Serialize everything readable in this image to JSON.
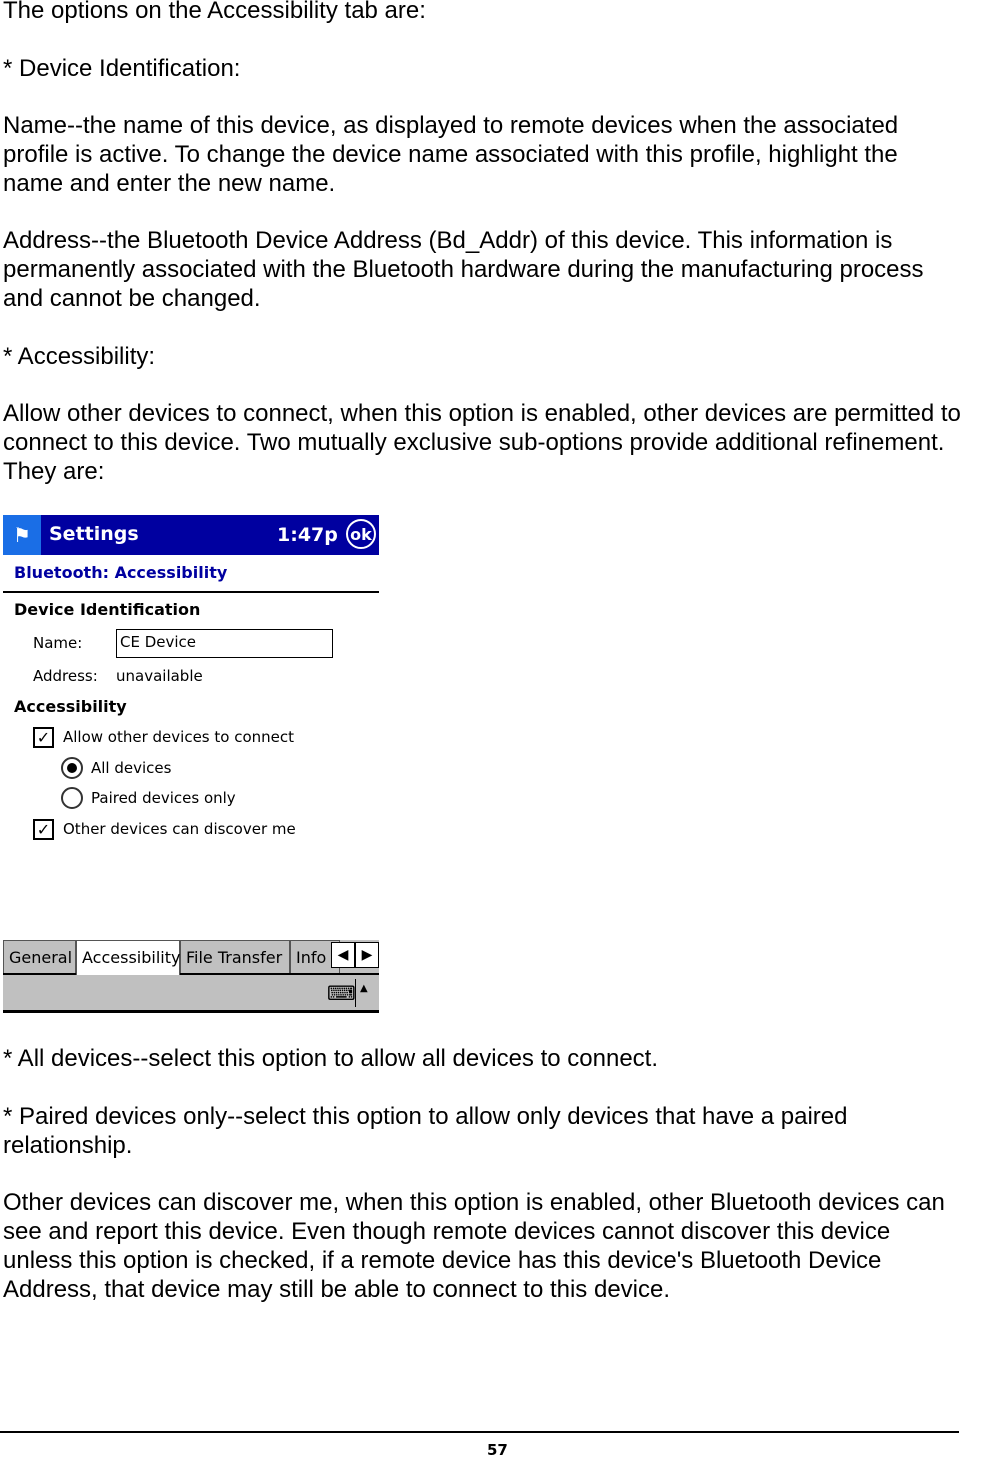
{
  "paragraphs": [
    "The options on the Accessibility tab are:",
    "* Device Identification:",
    "Name--the name of this device, as displayed to remote devices when the associated\nprofile is active. To change the device name associated with this profile, highlight the\nname and enter the new name.",
    "Address--the Bluetooth Device Address (Bd_Addr) of this device. This information is\npermanently associated with the Bluetooth hardware during the manufacturing process\nand cannot be changed.",
    "* Accessibility:",
    "Allow other devices to connect, when this option is enabled, other devices are permitted to\nconnect to this device. Two mutually exclusive sub-options provide additional refinement.\nThey are:",
    "* All devices--select this option to allow all devices to connect.",
    "* Paired devices only--select this option to allow only devices that have a paired\nrelationship.",
    "Other devices can discover me, when this option is enabled, other Bluetooth devices can\nsee and report this device. Even though remote devices cannot discover this device\nunless this option is checked, if a remote device has this device's Bluetooth Device\nAddress, that device may still be able to connect to this device."
  ],
  "screen": {
    "title": "Settings",
    "time": "1:47p",
    "ok": "ok",
    "subtitle": "Bluetooth: Accessibility",
    "device_id_heading": "Device Identification",
    "name_label": "Name:",
    "name_value": "CE Device",
    "address_label": "Address:",
    "address_value": "unavailable",
    "accessibility_heading": "Accessibility",
    "allow_connect": {
      "label": "Allow other devices to connect",
      "checked": true
    },
    "all_devices": {
      "label": "All devices",
      "selected": true
    },
    "paired_only": {
      "label": "Paired devices only",
      "selected": false
    },
    "discover": {
      "label": "Other devices can discover me",
      "checked": true
    },
    "tabs": [
      "General",
      "Accessibility",
      "File Transfer",
      "Info"
    ],
    "active_tab": "Accessibility",
    "titlebar_color": "#0000a0"
  },
  "page_number": "57"
}
